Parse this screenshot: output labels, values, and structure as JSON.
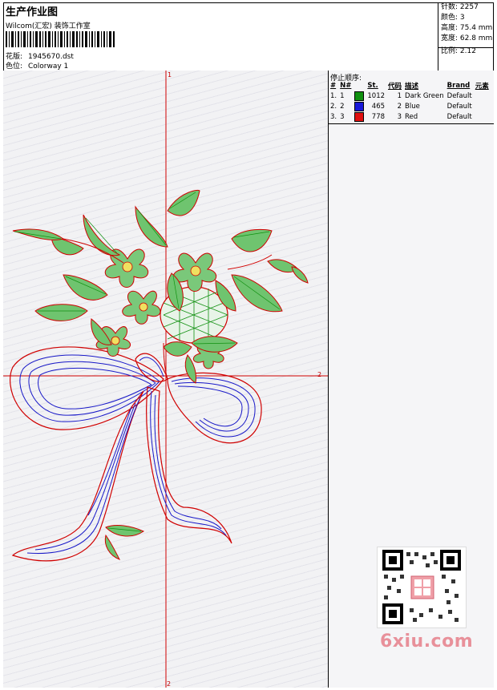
{
  "header": {
    "title": "生产作业图",
    "studio": "Wilcom(汇宏) 装饰工作室",
    "design_label": "花版:",
    "design_value": "1945670.dst",
    "colorway_label": "色位:",
    "colorway_value": "Colorway 1"
  },
  "stats": {
    "stitches": "针数: 2257",
    "colors": "颜色: 3",
    "height": "高度: 75.4 mm",
    "width": "宽度: 62.8 mm",
    "scale": "比例: 2.12"
  },
  "canvas": {
    "axis_top": "1",
    "axis_bottom": "2",
    "axis_right": "2",
    "colors": {
      "axis": "#d00000",
      "green": "#109010",
      "blue": "#1818c8",
      "red": "#d00000"
    }
  },
  "stop_sequence": {
    "title": "停止顺序:",
    "headers": [
      "#",
      "N#",
      "St.",
      "代码",
      "描述",
      "Brand",
      "元素"
    ],
    "rows": [
      {
        "idx": "1.",
        "n": "1",
        "color": "#109010",
        "st": "1012",
        "code": "1",
        "desc": "Dark Green",
        "brand": "Default"
      },
      {
        "idx": "2.",
        "n": "2",
        "color": "#1818d8",
        "st": "465",
        "code": "2",
        "desc": "Blue",
        "brand": "Default"
      },
      {
        "idx": "3.",
        "n": "3",
        "color": "#e01010",
        "st": "778",
        "code": "3",
        "desc": "Red",
        "brand": "Default"
      }
    ]
  },
  "watermark": {
    "text": "6xiu.com"
  }
}
